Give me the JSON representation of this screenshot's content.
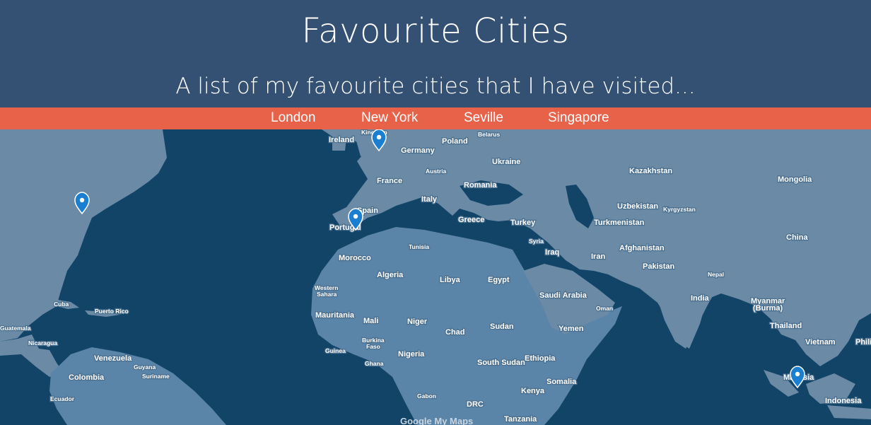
{
  "header": {
    "title": "Favourite Cities",
    "subtitle": "A list of my favourite cities that I have visited..."
  },
  "nav": {
    "items": [
      {
        "label": "London"
      },
      {
        "label": "New York"
      },
      {
        "label": "Seville"
      },
      {
        "label": "Singapore"
      }
    ]
  },
  "map": {
    "attribution": "Google My Maps",
    "pins": [
      {
        "city": "London",
        "icon": "map-pin-icon"
      },
      {
        "city": "New York",
        "icon": "map-pin-icon"
      },
      {
        "city": "Seville",
        "icon": "map-pin-icon"
      },
      {
        "city": "Singapore",
        "icon": "map-pin-icon"
      }
    ],
    "country_labels": [
      "Ireland",
      "Kingdom",
      "Belarus",
      "Poland",
      "Germany",
      "Ukraine",
      "Austria",
      "Kazakhstan",
      "France",
      "Romania",
      "Mongolia",
      "Italy",
      "Spain",
      "Uzbekistan",
      "Kyrgyzstan",
      "Portugal",
      "Greece",
      "Turkey",
      "Turkmenistan",
      "China",
      "Tunisia",
      "Syria",
      "Afghanistan",
      "Iraq",
      "Iran",
      "Morocco",
      "Pakistan",
      "Algeria",
      "Libya",
      "Egypt",
      "Nepal",
      "Western",
      "Sahara",
      "Saudi Arabia",
      "India",
      "Myanmar",
      "(Burma)",
      "Oman",
      "Cuba",
      "Puerto Rico",
      "Mauritania",
      "Mali",
      "Niger",
      "Sudan",
      "Chad",
      "Yemen",
      "Thailand",
      "Guatemala",
      "Nicaragua",
      "Burkina",
      "Faso",
      "Vietnam",
      "Phili",
      "Venezuela",
      "Guinea",
      "Nigeria",
      "Ethiopia",
      "Guyana",
      "Suriname",
      "Colombia",
      "Ghana",
      "South Sudan",
      "Somalia",
      "Ecuador",
      "Gabon",
      "Kenya",
      "Indonesia",
      "DRC",
      "Tanzania",
      "Ma",
      "sia"
    ]
  },
  "colors": {
    "header_bg": "#345174",
    "nav_bg": "#e8624a",
    "ocean": "#124468",
    "land": "#5a84a8",
    "land_dark": "#6a8aa6",
    "pin": "#1a7fd0"
  }
}
